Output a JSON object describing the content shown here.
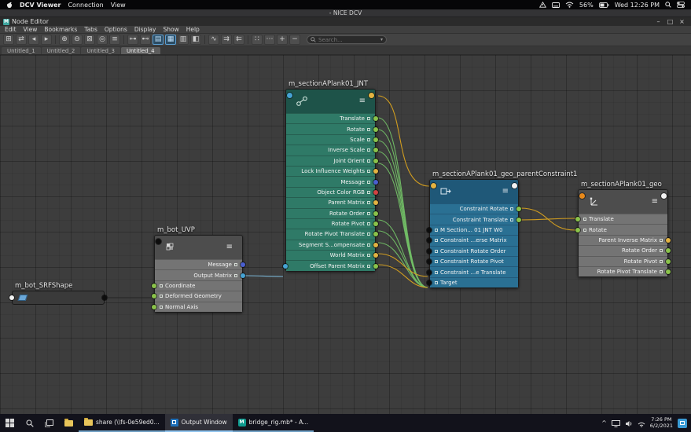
{
  "macos_bar": {
    "app_name": "DCV Viewer",
    "menus": [
      "Connection",
      "View"
    ],
    "battery_percent": "56%",
    "clock": "Wed 12:26 PM"
  },
  "dcv_titlebar": {
    "title": "- NICE DCV"
  },
  "window": {
    "title": "Node Editor",
    "logo_letter": "M",
    "controls": {
      "minimize": "–",
      "maximize": "□",
      "close": "×"
    },
    "menus": [
      "Edit",
      "View",
      "Bookmarks",
      "Tabs",
      "Options",
      "Display",
      "Show",
      "Help"
    ],
    "search_placeholder": "Search...",
    "tabs": [
      "Untitled_1",
      "Untitled_2",
      "Untitled_3",
      "Untitled_4"
    ]
  },
  "glyphs": {
    "hamburger": "≡",
    "chevron_down": "▾",
    "tray_caret": "^"
  },
  "toolbar": {
    "icons": [
      "⊞",
      "⇄",
      "◂",
      "▸",
      "⊕",
      "⊖",
      "⊠",
      "◎",
      "≡",
      "⊶",
      "⊷",
      "▤",
      "▦",
      "▥",
      "◧",
      "∿",
      "⇉",
      "⇇",
      "∷",
      "⋯",
      "+",
      "−"
    ]
  },
  "colors": {
    "wire_green": "#72bf66",
    "wire_yellow": "#d9a21f",
    "wire_cyan": "#7cb9da",
    "wire_dark": "#232323"
  },
  "nodes": {
    "jnt": {
      "title": "m_sectionAPlank01_JNT",
      "header_dot_left": "#46a3d4",
      "header_dot_right": "#e3b341",
      "rows": [
        {
          "label": "Translate",
          "out": "#8ac34a"
        },
        {
          "label": "Rotate",
          "out": "#8ac34a"
        },
        {
          "label": "Scale",
          "out": "#8ac34a"
        },
        {
          "label": "Inverse Scale",
          "out": "#8ac34a"
        },
        {
          "label": "Joint Orient",
          "out": "#8ac34a"
        },
        {
          "label": "Lock Influence Weights",
          "out": "#e3b341"
        },
        {
          "label": "Message",
          "out": "#4a5fd0"
        },
        {
          "label": "Object Color RGB",
          "out": "#d14343"
        },
        {
          "label": "Parent Matrix",
          "out": "#e3b341"
        },
        {
          "label": "Rotate Order",
          "out": "#8ac34a"
        },
        {
          "label": "Rotate Pivot",
          "out": "#8ac34a"
        },
        {
          "label": "Rotate Pivot Translate",
          "out": "#8ac34a"
        },
        {
          "label": "Segment S...ompensate",
          "out": "#e3b341"
        },
        {
          "label": "World Matrix",
          "out": "#e3b341"
        },
        {
          "label": "Offset Parent Matrix",
          "out": "#8ac34a",
          "in": "#46a3d4"
        }
      ]
    },
    "constraint": {
      "title": "m_sectionAPlank01_geo_parentConstraint1",
      "header_dot_left": "#e3b341",
      "header_dot_right": "#f2f2f2",
      "rows": [
        {
          "label": "Constraint Rotate",
          "out": "#8ac34a"
        },
        {
          "label": "Constraint Translate",
          "out": "#8ac34a"
        },
        {
          "label": "M Section... 01 JNT W0",
          "in": "#0d0d0d"
        },
        {
          "label": "Constraint ...erse Matrix",
          "in": "#0d0d0d"
        },
        {
          "label": "Constraint Rotate Order",
          "in": "#0d0d0d"
        },
        {
          "label": "Constraint Rotate Pivot",
          "in": "#0d0d0d"
        },
        {
          "label": "Constraint ...e Translate",
          "in": "#0d0d0d"
        },
        {
          "label": "Target",
          "in": "#0d0d0d"
        }
      ]
    },
    "geo": {
      "title": "m_sectionAPlank01_geo",
      "header_dot_left": "#e8891a",
      "header_dot_right": "#f2f2f2",
      "rows": [
        {
          "label": "Translate",
          "in": "#8ac34a"
        },
        {
          "label": "Rotate",
          "in": "#8ac34a"
        },
        {
          "label": "Parent Inverse Matrix",
          "out": "#e3b341"
        },
        {
          "label": "Rotate Order",
          "out": "#8ac34a"
        },
        {
          "label": "Rotate Pivot",
          "out": "#8ac34a"
        },
        {
          "label": "Rotate Pivot Translate",
          "out": "#8ac34a"
        }
      ]
    },
    "uvp": {
      "title": "m_bot_UVP",
      "header_dot_left": "#0d0d0d",
      "rows": [
        {
          "label": "Message",
          "out": "#4a5fd0"
        },
        {
          "label": "Output Matrix",
          "out": "#46a3d4"
        },
        {
          "label": "Coordinate",
          "in": "#8ac34a"
        },
        {
          "label": "Deformed Geometry",
          "in": "#8ac34a"
        },
        {
          "label": "Normal Axis",
          "in": "#8ac34a"
        }
      ]
    },
    "srf": {
      "title": "m_bot_SRFShape",
      "dot_left": "#f2f2f2",
      "dot_right": "#0d0d0d"
    }
  },
  "taskbar": {
    "apps": [
      {
        "label": "share (\\\\fs-0e59ed0..."
      },
      {
        "label": "Output Window"
      },
      {
        "label": "bridge_rig.mb* - A..."
      }
    ],
    "time": "7:26 PM",
    "date": "6/2/2021"
  }
}
